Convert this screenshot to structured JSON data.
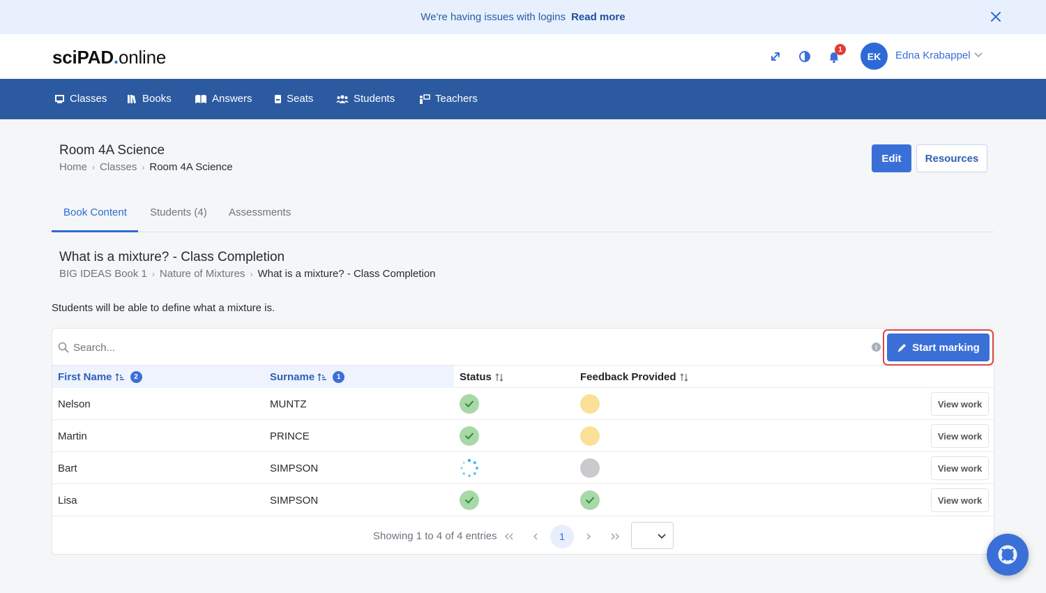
{
  "banner": {
    "message": "We're having issues with logins",
    "link": "Read more"
  },
  "header": {
    "logo_bold": "sciPAD",
    "logo_dot": ".",
    "logo_rest": "online",
    "notification_count": "1",
    "user_initials": "EK",
    "user_name": "Edna Krabappel"
  },
  "nav": {
    "items": [
      {
        "label": "Classes",
        "icon": "classroom-icon"
      },
      {
        "label": "Books",
        "icon": "books-icon"
      },
      {
        "label": "Answers",
        "icon": "open-book-icon"
      },
      {
        "label": "Seats",
        "icon": "seat-icon"
      },
      {
        "label": "Students",
        "icon": "students-icon"
      },
      {
        "label": "Teachers",
        "icon": "teacher-icon"
      }
    ]
  },
  "page": {
    "title": "Room 4A Science",
    "breadcrumb": [
      "Home",
      "Classes",
      "Room 4A Science"
    ],
    "edit_label": "Edit",
    "resources_label": "Resources"
  },
  "tabs": [
    "Book Content",
    "Students (4)",
    "Assessments"
  ],
  "content": {
    "title": "What is a mixture? - Class Completion",
    "breadcrumb": [
      "BIG IDEAS Book 1",
      "Nature of Mixtures",
      "What is a mixture? - Class Completion"
    ],
    "description": "Students will be able to define what a mixture is."
  },
  "table": {
    "search_placeholder": "Search...",
    "start_marking_label": "Start marking",
    "columns": {
      "first_name": "First Name",
      "first_name_sort_order": "2",
      "surname": "Surname",
      "surname_sort_order": "1",
      "status": "Status",
      "feedback": "Feedback Provided"
    },
    "rows": [
      {
        "first": "Nelson",
        "surname": "MUNTZ",
        "status": "complete",
        "feedback": "pending"
      },
      {
        "first": "Martin",
        "surname": "PRINCE",
        "status": "complete",
        "feedback": "pending"
      },
      {
        "first": "Bart",
        "surname": "SIMPSON",
        "status": "in-progress",
        "feedback": "none"
      },
      {
        "first": "Lisa",
        "surname": "SIMPSON",
        "status": "complete",
        "feedback": "complete"
      }
    ],
    "view_label": "View work",
    "footer_info": "Showing 1 to 4 of 4 entries",
    "current_page": "1",
    "page_size": ""
  },
  "colors": {
    "primary": "#3b6fd8",
    "navbar": "#2c5aa0",
    "status_complete": "#a8d8a8",
    "status_pending": "#fbe09a",
    "status_none": "#c8cacd",
    "highlight_border": "#e0453f"
  }
}
